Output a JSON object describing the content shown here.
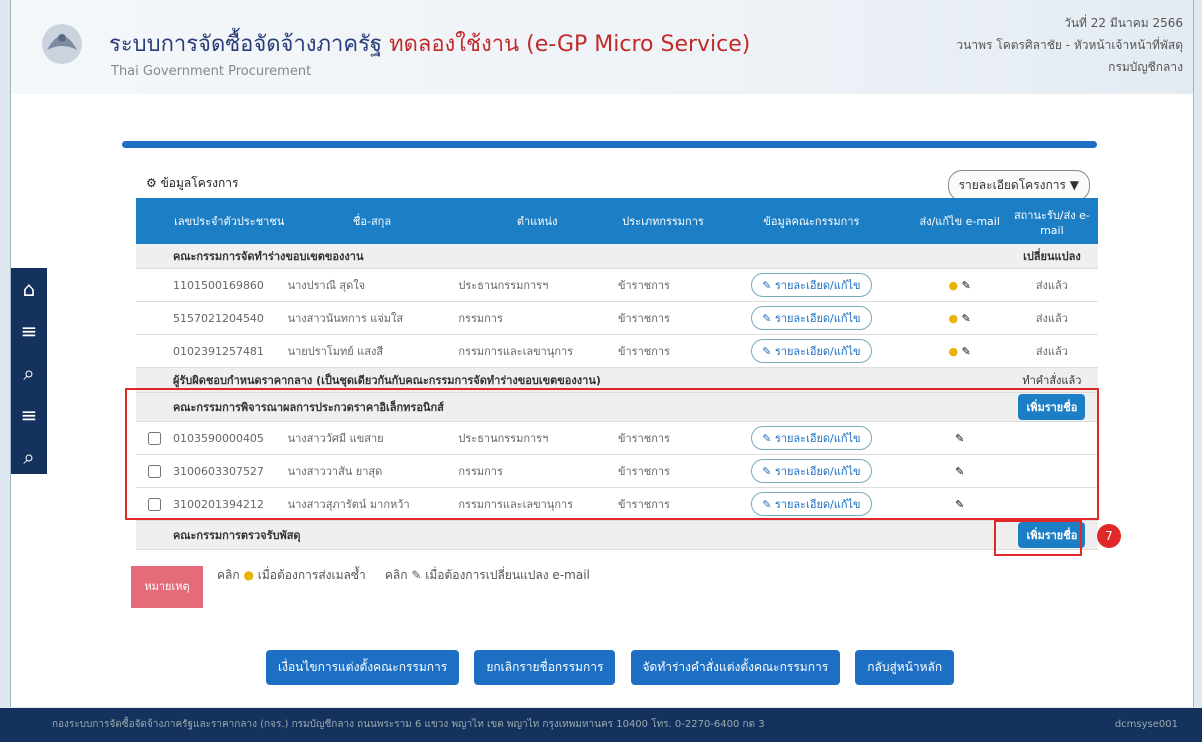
{
  "header": {
    "title_main": "ระบบการจัดซื้อจัดจ้างภาครัฐ",
    "title_red": "ทดลองใช้งาน (e-GP Micro Service)",
    "subtitle": "Thai Government Procurement",
    "date": "วันที่ 22 มีนาคม 2566",
    "user": "วนาพร โคตรศิลาชัย - หัวหน้าเจ้าหน้าที่พัสดุ",
    "dept": "กรมบัญชีกลาง"
  },
  "panel": {
    "title": "ข้อมูลโครงการ",
    "detail_button": "รายละเอียดโครงการ"
  },
  "table": {
    "headers": [
      "เลขประจำตัวประชาชน",
      "ชื่อ-สกุล",
      "ตำแหน่ง",
      "ประเภทกรรมการ",
      "ข้อมูลคณะกรรมการ",
      "ส่ง/แก้ไข e-mail",
      "สถานะรับ/ส่ง e-mail"
    ],
    "groups": [
      {
        "name": "คณะกรรมการจัดทำร่างขอบเขตของงาน",
        "action": "เปลี่ยนแปลง",
        "rows": [
          {
            "id": "1101500169860",
            "name": "นางปราณี สุดใจ",
            "role": "ประธานกรรมการฯ",
            "type": "ข้าราชการ",
            "btn": "รายละเอียด/แก้ไข",
            "status": "ส่งแล้ว"
          },
          {
            "id": "5157021204540",
            "name": "นางสาวนันทการ แจ่มใส",
            "role": "กรรมการ",
            "type": "ข้าราชการ",
            "btn": "รายละเอียด/แก้ไข",
            "status": "ส่งแล้ว"
          },
          {
            "id": "0102391257481",
            "name": "นายปราโมทย์ แสงสี",
            "role": "กรรมการและเลขานุการ",
            "type": "ข้าราชการ",
            "btn": "รายละเอียด/แก้ไข",
            "status": "ส่งแล้ว"
          }
        ]
      },
      {
        "name": "ผู้รับผิดชอบกำหนดราคากลาง (เป็นชุดเดียวกันกับคณะกรรมการจัดทำร่างขอบเขตของงาน)",
        "action": "ทำคำสั่งแล้ว",
        "rows": []
      },
      {
        "name": "คณะกรรมการพิจารณาผลการประกวดราคาอิเล็กทรอนิกส์",
        "action": "เพิ่มรายชื่อ",
        "rows": [
          {
            "id": "0103590000405",
            "name": "นางสาววัศมี แขสาย",
            "role": "ประธานกรรมการฯ",
            "type": "ข้าราชการ",
            "btn": "รายละเอียด/แก้ไข",
            "status": ""
          },
          {
            "id": "3100603307527",
            "name": "นางสาววาสัน ยาสุด",
            "role": "กรรมการ",
            "type": "ข้าราชการ",
            "btn": "รายละเอียด/แก้ไข",
            "status": ""
          },
          {
            "id": "3100201394212",
            "name": "นางสาวสุภารัตน์ มากหว้า",
            "role": "กรรมการและเลขานุการ",
            "type": "ข้าราชการ",
            "btn": "รายละเอียด/แก้ไข",
            "status": ""
          }
        ]
      },
      {
        "name": "คณะกรรมการตรวจรับพัสดุ",
        "action": "เพิ่มรายชื่อ",
        "rows": []
      }
    ]
  },
  "step_number": "7",
  "note": {
    "tab": "หมายเหตุ",
    "click1": "คลิก",
    "text1": "เมื่อต้องการส่งเมลซ้ำ",
    "click2": "คลิก",
    "text2": "เมื่อต้องการเปลี่ยนแปลง e-mail"
  },
  "actions": [
    "เงื่อนไขการแต่งตั้งคณะกรรมการ",
    "ยกเลิกรายชื่อกรรมการ",
    "จัดทำร่างคำสั่งแต่งตั้งคณะกรรมการ",
    "กลับสู่หน้าหลัก"
  ],
  "footer": {
    "left": "กองระบบการจัดซื้อจัดจ้างภาครัฐและราคากลาง (กจร.) กรมบัญชีกลาง ถนนพระราม 6 แขวง พญาไท เขต พญาไท กรุงเทพมหานคร 10400 โทร. 0-2270-6400 กด 3",
    "right": "dcmsyse001"
  }
}
